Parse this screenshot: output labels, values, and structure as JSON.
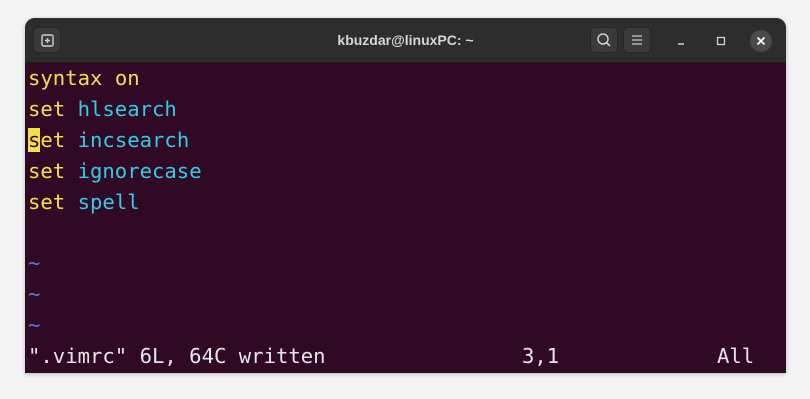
{
  "window": {
    "title": "kbuzdar@linuxPC: ~"
  },
  "icons": {
    "new_tab": "new-tab-icon",
    "search": "search-icon",
    "menu": "hamburger-menu-icon",
    "minimize": "minimize-icon",
    "maximize": "maximize-icon",
    "close": "close-icon"
  },
  "colors": {
    "terminal_bg": "#300a24",
    "keyword": "#f1e04a",
    "option": "#34cbe6",
    "tilde": "#5a78e0",
    "titlebar_bg": "#2d2d2d"
  },
  "editor": {
    "lines": [
      {
        "keyword": "syntax",
        "value": "on"
      },
      {
        "keyword": "set",
        "value": "hlsearch"
      },
      {
        "keyword_cursor_char": "s",
        "keyword_rest": "et",
        "value": "incsearch"
      },
      {
        "keyword": "set",
        "value": "ignorecase"
      },
      {
        "keyword": "set",
        "value": "spell"
      }
    ],
    "empty_marker": "~",
    "status": {
      "message": "\".vimrc\" 6L, 64C written",
      "position": "3,1",
      "scroll": "All"
    }
  }
}
